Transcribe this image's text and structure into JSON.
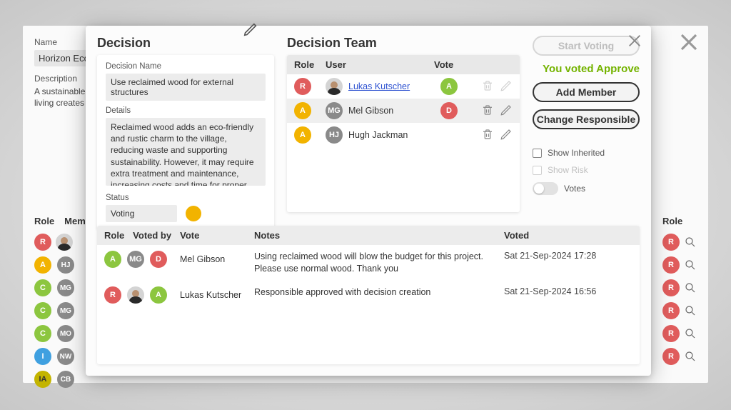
{
  "background": {
    "name_label": "Name",
    "name_value": "Horizon Eco…",
    "desc_label": "Description",
    "desc_value": "A sustainable village focused on eco-living creates a clo…",
    "left_cols": {
      "role": "Role",
      "member": "Memb…"
    },
    "right_cols": {
      "role": "Role"
    },
    "left_rows": [
      {
        "role": "R",
        "class": "badge-r",
        "avatar": true
      },
      {
        "role": "A",
        "class": "badge-amber",
        "initials": "HJ"
      },
      {
        "role": "C",
        "class": "badge-a",
        "initials": "MG"
      },
      {
        "role": "C",
        "class": "badge-a",
        "initials": "MG"
      },
      {
        "role": "C",
        "class": "badge-a",
        "initials": "MO"
      },
      {
        "role": "I",
        "class": "badge-i",
        "initials": "NW"
      },
      {
        "role": "IA",
        "class": "badge-ia",
        "initials": "CB"
      }
    ],
    "right_rows": [
      {
        "role": "R"
      },
      {
        "role": "R"
      },
      {
        "role": "R"
      },
      {
        "role": "R"
      },
      {
        "role": "R"
      },
      {
        "role": "R"
      }
    ]
  },
  "modal": {
    "decision_heading": "Decision",
    "name_label": "Decision Name",
    "name_value": "Use reclaimed wood for external structures",
    "details_label": "Details",
    "details_value": "Reclaimed wood adds an eco-friendly and rustic charm to the village, reducing waste and supporting sustainability. However, it may require extra treatment and maintenance, increasing costs and time for proper integration.",
    "status_label": "Status",
    "status_value": "Voting",
    "team_heading": "Decision Team",
    "team_cols": {
      "role": "Role",
      "user": "User",
      "vote": "Vote"
    },
    "team": [
      {
        "role": "R",
        "role_class": "badge-r",
        "avatar": true,
        "initials": "",
        "name": "Lukas Kutscher",
        "link": true,
        "vote": "A",
        "vote_class": "badge-a",
        "actions_disabled": true,
        "selected": false
      },
      {
        "role": "A",
        "role_class": "badge-amber",
        "avatar": false,
        "initials": "MG",
        "name": "Mel Gibson",
        "link": false,
        "vote": "D",
        "vote_class": "badge-d",
        "actions_disabled": false,
        "selected": true
      },
      {
        "role": "A",
        "role_class": "badge-amber",
        "avatar": false,
        "initials": "HJ",
        "name": "Hugh Jackman",
        "link": false,
        "vote": "",
        "vote_class": "",
        "actions_disabled": false,
        "selected": false
      }
    ],
    "actions": {
      "start_voting": "Start Voting",
      "voted_approve": "You voted Approve",
      "add_member": "Add Member",
      "change_responsible": "Change Responsible",
      "show_inherited": "Show Inherited",
      "show_risk": "Show Risk",
      "votes_toggle": "Votes"
    },
    "votes_cols": {
      "role": "Role",
      "voted_by": "Voted by",
      "vote": "Vote",
      "notes": "Notes",
      "voted": "Voted"
    },
    "votes": [
      {
        "role": "A",
        "role_class": "badge-a",
        "avatar": false,
        "initials": "MG",
        "vote": "D",
        "vote_class": "badge-d",
        "who": "Mel Gibson",
        "notes": "Using reclaimed wood will blow the budget for this project. Please use normal wood. Thank you",
        "when": "Sat 21-Sep-2024 17:28"
      },
      {
        "role": "R",
        "role_class": "badge-r",
        "avatar": true,
        "initials": "",
        "vote": "A",
        "vote_class": "badge-a",
        "who": "Lukas Kutscher",
        "notes": "Responsible approved with decision creation",
        "when": "Sat 21-Sep-2024 16:56"
      }
    ]
  }
}
